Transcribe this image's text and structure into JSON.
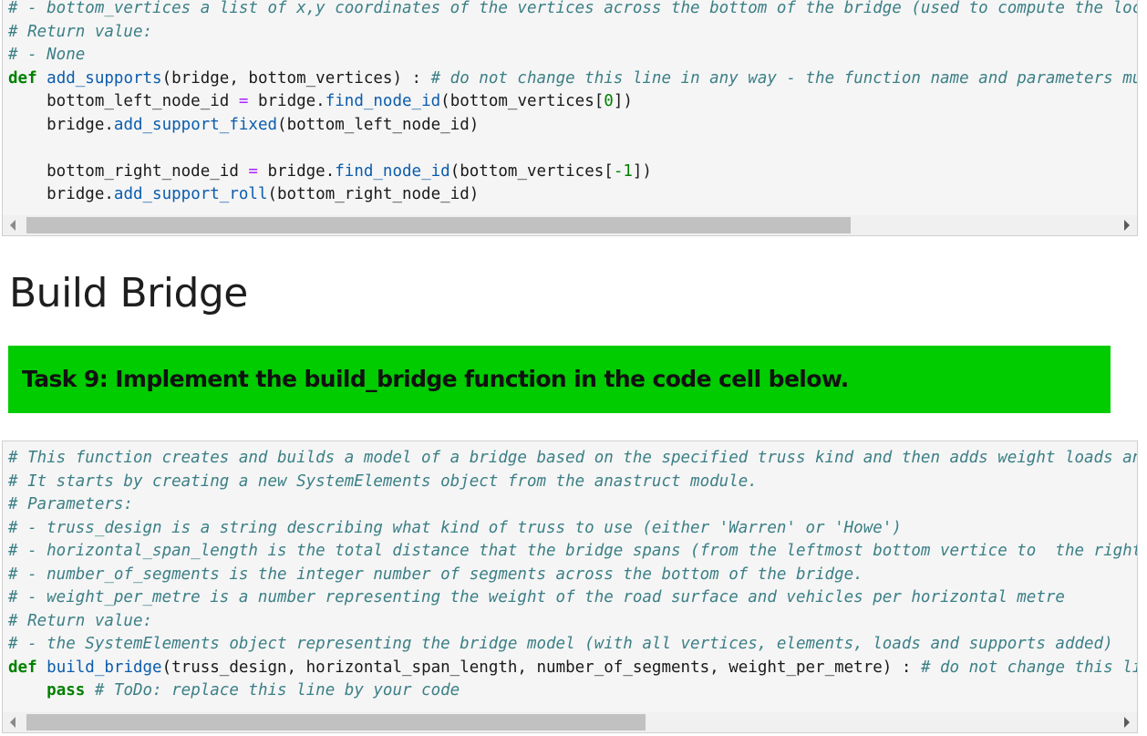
{
  "top_cell": {
    "lines": [
      [
        {
          "t": "# - bottom_vertices a list of x,y coordinates of the vertices across the bottom of the bridge (used to compute the locations",
          "c": "cm"
        }
      ],
      [
        {
          "t": "# Return value:",
          "c": "cm"
        }
      ],
      [
        {
          "t": "# - None",
          "c": "cm"
        }
      ],
      [
        {
          "t": "def",
          "c": "kw"
        },
        {
          "t": " "
        },
        {
          "t": "add_supports",
          "c": "fn"
        },
        {
          "t": "(bridge, bottom_vertices) : "
        },
        {
          "t": "# do not change this line in any way - the function name and parameters must",
          "c": "cm"
        }
      ],
      [
        {
          "t": "    bottom_left_node_id "
        },
        {
          "t": "=",
          "c": "op"
        },
        {
          "t": " bridge."
        },
        {
          "t": "find_node_id",
          "c": "fn"
        },
        {
          "t": "(bottom_vertices["
        },
        {
          "t": "0",
          "c": "num"
        },
        {
          "t": "])"
        }
      ],
      [
        {
          "t": "    bridge."
        },
        {
          "t": "add_support_fixed",
          "c": "fn"
        },
        {
          "t": "(bottom_left_node_id)"
        }
      ],
      [
        {
          "t": ""
        }
      ],
      [
        {
          "t": "    bottom_right_node_id "
        },
        {
          "t": "=",
          "c": "op"
        },
        {
          "t": " bridge."
        },
        {
          "t": "find_node_id",
          "c": "fn"
        },
        {
          "t": "(bottom_vertices["
        },
        {
          "t": "-1",
          "c": "num"
        },
        {
          "t": "])"
        }
      ],
      [
        {
          "t": "    bridge."
        },
        {
          "t": "add_support_roll",
          "c": "fn"
        },
        {
          "t": "(bottom_right_node_id)"
        }
      ]
    ]
  },
  "section_heading": "Build Bridge",
  "task_banner": "Task 9: Implement the build_bridge function in the code cell below.",
  "bottom_cell": {
    "lines": [
      [
        {
          "t": "# This function creates and builds a model of a bridge based on the specified truss kind and then adds weight loads and",
          "c": "cm"
        }
      ],
      [
        {
          "t": "# It starts by creating a new SystemElements object from the anastruct module.",
          "c": "cm"
        }
      ],
      [
        {
          "t": "# Parameters:",
          "c": "cm"
        }
      ],
      [
        {
          "t": "# - truss_design is a string describing what kind of truss to use (either 'Warren' or 'Howe')",
          "c": "cm"
        }
      ],
      [
        {
          "t": "# - horizontal_span_length is the total distance that the bridge spans (from the leftmost bottom vertice to  the right",
          "c": "cm"
        }
      ],
      [
        {
          "t": "# - number_of_segments is the integer number of segments across the bottom of the bridge.",
          "c": "cm"
        }
      ],
      [
        {
          "t": "# - weight_per_metre is a number representing the weight of the road surface and vehicles per horizontal metre",
          "c": "cm"
        }
      ],
      [
        {
          "t": "# Return value:",
          "c": "cm"
        }
      ],
      [
        {
          "t": "# - the SystemElements object representing the bridge model (with all vertices, elements, loads and supports added)",
          "c": "cm"
        }
      ],
      [
        {
          "t": "def",
          "c": "kw"
        },
        {
          "t": " "
        },
        {
          "t": "build_bridge",
          "c": "fn"
        },
        {
          "t": "(truss_design, horizontal_span_length, number_of_segments, weight_per_metre) : "
        },
        {
          "t": "# do not change this line",
          "c": "cm"
        }
      ],
      [
        {
          "t": "    "
        },
        {
          "t": "pass",
          "c": "kw"
        },
        {
          "t": " "
        },
        {
          "t": "# ToDo: replace this line by your code",
          "c": "cm"
        }
      ]
    ]
  }
}
